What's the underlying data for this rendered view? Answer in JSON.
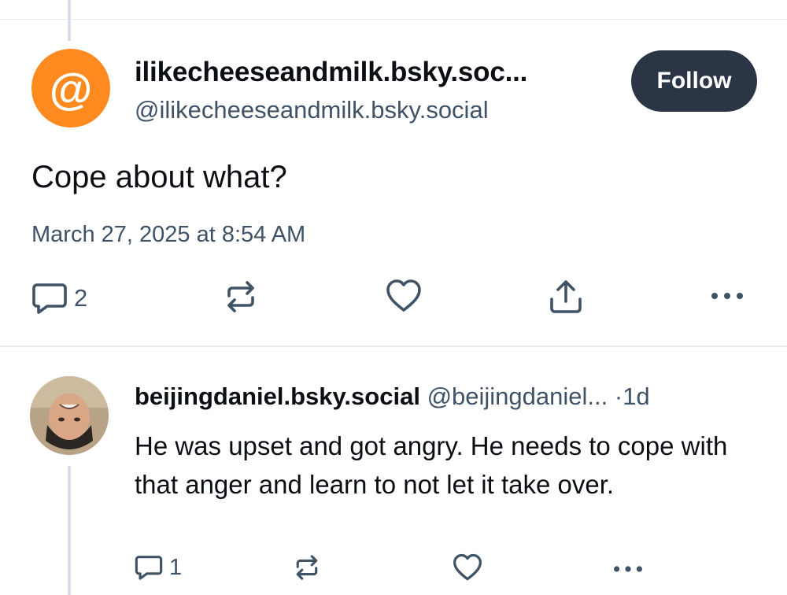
{
  "post": {
    "display_name": "ilikecheeseandmilk.bsky.soc...",
    "handle": "@ilikecheeseandmilk.bsky.social",
    "avatar_glyph": "@",
    "avatar_color": "#ff8a1f",
    "follow_label": "Follow",
    "text": "Cope about what?",
    "timestamp": "March 27, 2025 at 8:54 AM",
    "reply_count": "2",
    "icons": [
      "reply-icon",
      "repost-icon",
      "like-icon",
      "share-icon",
      "more-icon"
    ]
  },
  "reply": {
    "display_name": "beijingdaniel.bsky.social",
    "handle": "@beijingdaniel...",
    "separator": "·",
    "age": "1d",
    "text": "He was upset and got angry.  He needs to cope with that anger and learn to not let it take over.",
    "reply_count": "1",
    "icons": [
      "reply-icon",
      "repost-icon",
      "like-icon",
      "more-icon"
    ]
  },
  "colors": {
    "follow_button": "#2c3546",
    "muted_text": "#3f5266",
    "thread_line": "#d9dee6"
  }
}
